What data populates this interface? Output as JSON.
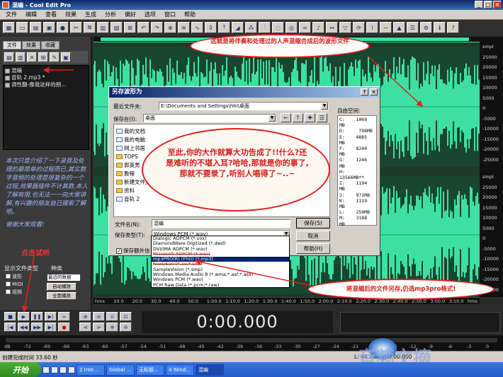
{
  "window": {
    "title": "混编 - Cool Edit Pro"
  },
  "menu": [
    "文件",
    "编辑",
    "查看",
    "效果",
    "生成",
    "分析",
    "偏好",
    "选项",
    "窗口",
    "帮助"
  ],
  "left_panel": {
    "tabs": [
      "文件",
      "效果",
      "收藏"
    ],
    "files": [
      "混编",
      "音轨 2.mp3 *",
      "调性翻-像我这样的朋..."
    ],
    "note": "本次只是介绍了一下录音及处理的最简单的过程而已,其实数字音频的处理是很复杂的一个过程,效果器插件不计其数,本人了解有限,也无法一一向大家讲解,有兴趣的朋友自己摸索了解吧。",
    "thanks": "谢谢大家观看!",
    "show_label": "显示文件类型",
    "sort_label": "种类",
    "checkboxes": [
      "波形",
      "MIDI",
      "视频"
    ],
    "sort_value": "最近的数据",
    "btn_auto": "自动播放",
    "btn_full": "全面播放"
  },
  "wave": {
    "scale_labels": [
      "smpl",
      "25000",
      "20000",
      "15000",
      "10000",
      "5000",
      "0",
      "-5000",
      "-10000",
      "-15000",
      "-20000",
      "-25000",
      "smpl",
      "25000",
      "20000",
      "15000",
      "10000",
      "5000",
      "0",
      "-5000",
      "-10000",
      "-15000",
      "-20000",
      "-25000"
    ],
    "time_labels": [
      "hms",
      "10.0",
      "20.0",
      "30.0",
      "40.0",
      "50.0",
      "1:00.0",
      "1:10.0",
      "1:20.0",
      "1:30.0",
      "1:40.0",
      "1:50.0",
      "2:00.0",
      "2:10.0",
      "2:20.0",
      "2:30.0",
      "2:40.0",
      "2:50.0",
      "3:00.0",
      "3:10.0",
      "hms"
    ]
  },
  "transport": {
    "time": "0:00.000"
  },
  "levels": [
    "dB",
    "-72",
    "-69",
    "-66",
    "-63",
    "-60",
    "-57",
    "-54",
    "-51",
    "-48",
    "-45",
    "-42",
    "-39",
    "-36",
    "-33",
    "-30",
    "-27",
    "-24",
    "-21",
    "-18",
    "-15",
    "-12",
    "-9",
    "-6",
    "-3",
    "0"
  ],
  "status": {
    "left": "创建完成时间 33.60 秒",
    "right": "L: 44.2dB @ 0:00.000"
  },
  "taskbar": {
    "start": "开始",
    "tasks": [
      "2 Inte...",
      "Global ...",
      "无标题...",
      "4 Wind...",
      "混编"
    ]
  },
  "watermark": "音频文摘",
  "dialog": {
    "title": "另存波形为",
    "recent_label": "最近文件夹:",
    "recent_value": "E:\\Documents and Settings\\hhi\\桌面",
    "save_in_label": "保存在(I):",
    "save_in_value": "桌面",
    "folders": [
      "我的文档",
      "我的电脑",
      "网上邻居",
      "TOPS",
      "郭英男",
      "教程",
      "新建文件夹",
      "资料",
      "音轨 2"
    ],
    "free_space_label": "自由空间:",
    "free_space": [
      "C:    1069",
      "MB",
      "D:     796MB",
      "E:    4885",
      "MB",
      "F:    8240",
      "MB",
      "G:    1246",
      "MB",
      "H:",
      "13566MB**",
      "I:    1194",
      "MB",
      "J:    971MB",
      "K:    1119",
      "MB",
      "L:    250MB",
      "M:    3188",
      "MB"
    ],
    "filename_label": "文件名(N):",
    "filename_value": "混编",
    "filetype_label": "保存类型(T):",
    "filetype_value": "Windows PCM (*.wav)",
    "btn_save": "保存(S)",
    "btn_cancel": "取消",
    "btn_help": "帮助(H)",
    "check_label": "保存额外信",
    "type_options": [
      "Dialogic ADPCM (*.vox)",
      "DiamondWare Digitized (*.dwd)",
      "DVI/IMA ADPCM (*.wav)",
      "Microsoft ADPCM (*.wav)",
      "mp3PRO(R) (FhG) (*.mp3)",
      "Next/Sun (*.au;*.snd)",
      "SampleVision (*.smp)",
      "Windows Media Audio 8 (*.wma;*.asf;*.asx)",
      "Windows PCM (*.wav)",
      "PCM Raw Data (*.pcm;*.raw)"
    ]
  },
  "annotations": {
    "top": "这就是将伴奏和处理过的人声混缩合成后的波形文件",
    "center": "至此,你的大作就算大功告成了!!什么?还是难听的不堪入耳?哈哈,那就是你的事了,那就不要录了,听别人唱得了~..~",
    "right": "将混缩后的文件另存,仍选mp3pro格式!",
    "click_hint": "点击试听"
  }
}
